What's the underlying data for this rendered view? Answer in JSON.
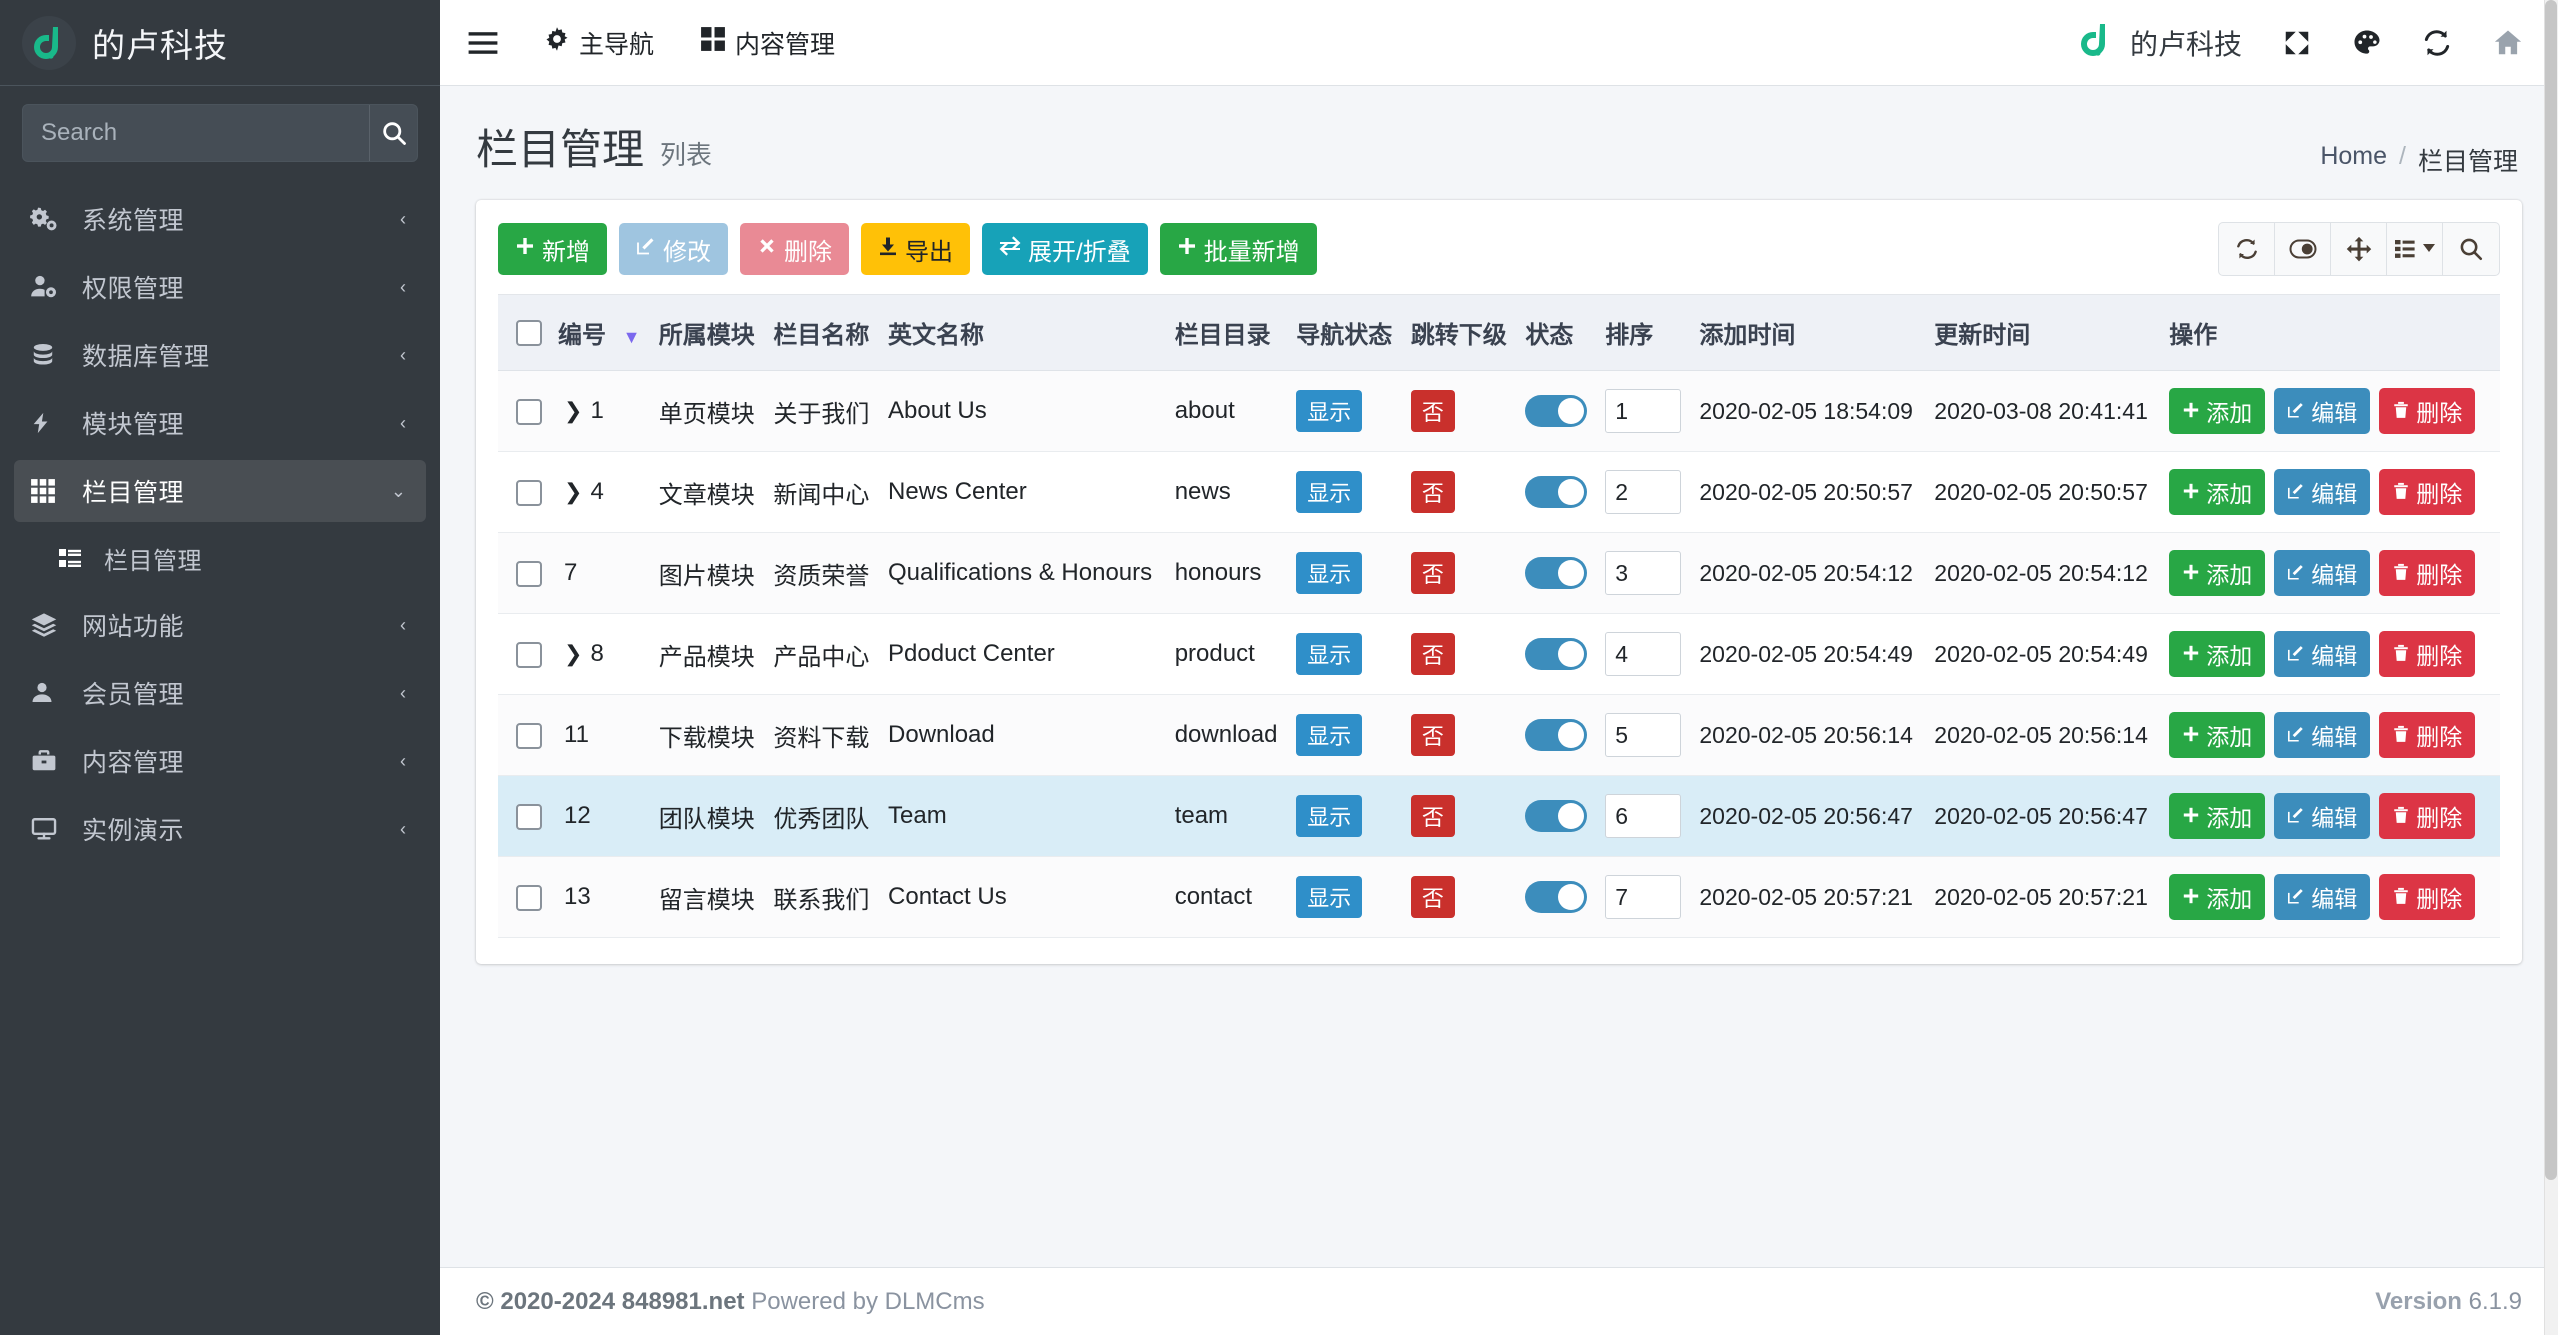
{
  "sidebar": {
    "brand": {
      "title": "的卢科技",
      "logo_icon": "dlu-logo-icon"
    },
    "search": {
      "placeholder": "Search",
      "value": "",
      "icon": "search-icon"
    },
    "items": [
      {
        "label": "系统管理",
        "icon": "cogs-icon",
        "caret": "‹",
        "active": false
      },
      {
        "label": "权限管理",
        "icon": "user-cog-icon",
        "caret": "‹",
        "active": false
      },
      {
        "label": "数据库管理",
        "icon": "database-icon",
        "caret": "‹",
        "active": false
      },
      {
        "label": "模块管理",
        "icon": "bolt-icon",
        "caret": "‹",
        "active": false
      },
      {
        "label": "栏目管理",
        "icon": "grid-icon",
        "caret": "⌄",
        "active": true
      },
      {
        "label": "网站功能",
        "icon": "layers-icon",
        "caret": "‹",
        "active": false
      },
      {
        "label": "会员管理",
        "icon": "user-icon",
        "caret": "‹",
        "active": false
      },
      {
        "label": "内容管理",
        "icon": "briefcase-icon",
        "caret": "‹",
        "active": false
      },
      {
        "label": "实例演示",
        "icon": "desktop-icon",
        "caret": "‹",
        "active": false
      }
    ],
    "submenu": {
      "label": "栏目管理",
      "icon": "list-icon"
    }
  },
  "topnav": {
    "menu_icon": "hamburger-icon",
    "left_items": [
      {
        "label": "主导航",
        "icon": "gear-icon"
      },
      {
        "label": "内容管理",
        "icon": "grid-icon"
      }
    ],
    "brand": {
      "label": "的卢科技",
      "icon": "dlu-logo-icon"
    },
    "right_icons": [
      {
        "name": "fullscreen-icon"
      },
      {
        "name": "palette-icon"
      },
      {
        "name": "refresh-icon"
      },
      {
        "name": "home-icon"
      }
    ]
  },
  "header": {
    "title": "栏目管理",
    "subtitle": "列表",
    "breadcrumb": {
      "home": "Home",
      "separator": "/",
      "current": "栏目管理"
    }
  },
  "toolbar": {
    "buttons": [
      {
        "label": "新增",
        "icon": "plus-icon",
        "style": "tbtn-green"
      },
      {
        "label": "修改",
        "icon": "edit-icon",
        "style": "tbtn-lblue"
      },
      {
        "label": "删除",
        "icon": "times-icon",
        "style": "tbtn-pink"
      },
      {
        "label": "导出",
        "icon": "download-icon",
        "style": "tbtn-amber"
      },
      {
        "label": "展开/折叠",
        "icon": "exchange-icon",
        "style": "tbtn-cyan"
      },
      {
        "label": "批量新增",
        "icon": "plus-icon",
        "style": "tbtn-green"
      }
    ],
    "icon_buttons": [
      {
        "name": "refresh-icon"
      },
      {
        "name": "toggle-icon"
      },
      {
        "name": "move-icon"
      },
      {
        "name": "columns-icon"
      },
      {
        "name": "search-icon"
      }
    ]
  },
  "table": {
    "columns": [
      "编号",
      "所属模块",
      "栏目名称",
      "英文名称",
      "栏目目录",
      "导航状态",
      "跳转下级",
      "状态",
      "排序",
      "添加时间",
      "更新时间",
      "操作"
    ],
    "sort_indicator": "▼",
    "row_actions": [
      {
        "label": "添加",
        "icon": "plus-icon",
        "style": "abtn-green"
      },
      {
        "label": "编辑",
        "icon": "edit-icon",
        "style": "abtn-blue"
      },
      {
        "label": "删除",
        "icon": "trash-icon",
        "style": "abtn-red"
      }
    ],
    "rows": [
      {
        "id": "1",
        "expandable": true,
        "module": "单页模块",
        "name": "关于我们",
        "en": "About Us",
        "dir": "about",
        "nav": "显示",
        "jump": "否",
        "status_on": true,
        "sort": "1",
        "created": "2020-02-05 18:54:09",
        "updated": "2020-03-08 20:41:41",
        "highlight": false
      },
      {
        "id": "4",
        "expandable": true,
        "module": "文章模块",
        "name": "新闻中心",
        "en": "News Center",
        "dir": "news",
        "nav": "显示",
        "jump": "否",
        "status_on": true,
        "sort": "2",
        "created": "2020-02-05 20:50:57",
        "updated": "2020-02-05 20:50:57",
        "highlight": false
      },
      {
        "id": "7",
        "expandable": false,
        "module": "图片模块",
        "name": "资质荣誉",
        "en": "Qualifications & Honours",
        "dir": "honours",
        "nav": "显示",
        "jump": "否",
        "status_on": true,
        "sort": "3",
        "created": "2020-02-05 20:54:12",
        "updated": "2020-02-05 20:54:12",
        "highlight": false
      },
      {
        "id": "8",
        "expandable": true,
        "module": "产品模块",
        "name": "产品中心",
        "en": "Pdoduct Center",
        "dir": "product",
        "nav": "显示",
        "jump": "否",
        "status_on": true,
        "sort": "4",
        "created": "2020-02-05 20:54:49",
        "updated": "2020-02-05 20:54:49",
        "highlight": false
      },
      {
        "id": "11",
        "expandable": false,
        "module": "下载模块",
        "name": "资料下载",
        "en": "Download",
        "dir": "download",
        "nav": "显示",
        "jump": "否",
        "status_on": true,
        "sort": "5",
        "created": "2020-02-05 20:56:14",
        "updated": "2020-02-05 20:56:14",
        "highlight": false
      },
      {
        "id": "12",
        "expandable": false,
        "module": "团队模块",
        "name": "优秀团队",
        "en": "Team",
        "dir": "team",
        "nav": "显示",
        "jump": "否",
        "status_on": true,
        "sort": "6",
        "created": "2020-02-05 20:56:47",
        "updated": "2020-02-05 20:56:47",
        "highlight": true
      },
      {
        "id": "13",
        "expandable": false,
        "module": "留言模块",
        "name": "联系我们",
        "en": "Contact Us",
        "dir": "contact",
        "nav": "显示",
        "jump": "否",
        "status_on": true,
        "sort": "7",
        "created": "2020-02-05 20:57:21",
        "updated": "2020-02-05 20:57:21",
        "highlight": false
      }
    ]
  },
  "footer": {
    "copyright_bold": "© 2020-2024 848981.net",
    "copyright_rest": " Powered by DLMCms",
    "version_label": "Version",
    "version_value": "6.1.9"
  },
  "colors": {
    "sidebar_bg": "#343a40",
    "accent_green": "#28a745",
    "accent_blue": "#3c8dbc",
    "accent_red": "#dc3545",
    "brand_teal": "#19b98a",
    "highlight_row": "#d9edf7"
  }
}
